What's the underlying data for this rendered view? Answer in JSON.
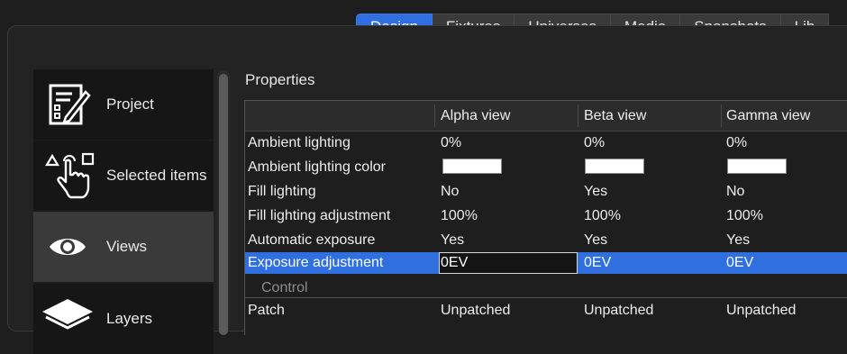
{
  "tabs": [
    "Design",
    "Fixtures",
    "Universes",
    "Media",
    "Snapshots",
    "Lib"
  ],
  "active_tab": 0,
  "sidebar": {
    "items": [
      {
        "label": "Project",
        "icon": "project-icon"
      },
      {
        "label": "Selected items",
        "icon": "selection-icon"
      },
      {
        "label": "Views",
        "icon": "eye-icon"
      },
      {
        "label": "Layers",
        "icon": "layers-icon"
      }
    ],
    "active_index": 2
  },
  "properties": {
    "title": "Properties",
    "columns": [
      "Alpha view",
      "Beta view",
      "Gamma view"
    ],
    "rows": [
      {
        "label": "Ambient lighting",
        "values": [
          "0%",
          "0%",
          "0%"
        ]
      },
      {
        "label": "Ambient lighting color",
        "values": [
          "",
          "",
          ""
        ],
        "swatch": "#ffffff"
      },
      {
        "label": "Fill lighting",
        "values": [
          "No",
          "Yes",
          "No"
        ]
      },
      {
        "label": "Fill lighting adjustment",
        "values": [
          "100%",
          "100%",
          "100%"
        ]
      },
      {
        "label": "Automatic exposure",
        "values": [
          "Yes",
          "Yes",
          "Yes"
        ]
      },
      {
        "label": "Exposure adjustment",
        "values": [
          "0EV",
          "0EV",
          "0EV"
        ],
        "selected": true
      }
    ],
    "section": "Control",
    "section_rows": [
      {
        "label": "Patch",
        "values": [
          "Unpatched",
          "Unpatched",
          "Unpatched"
        ]
      }
    ]
  },
  "colors": {
    "accent": "#2f6fe0",
    "background": "#1e1e1e"
  }
}
